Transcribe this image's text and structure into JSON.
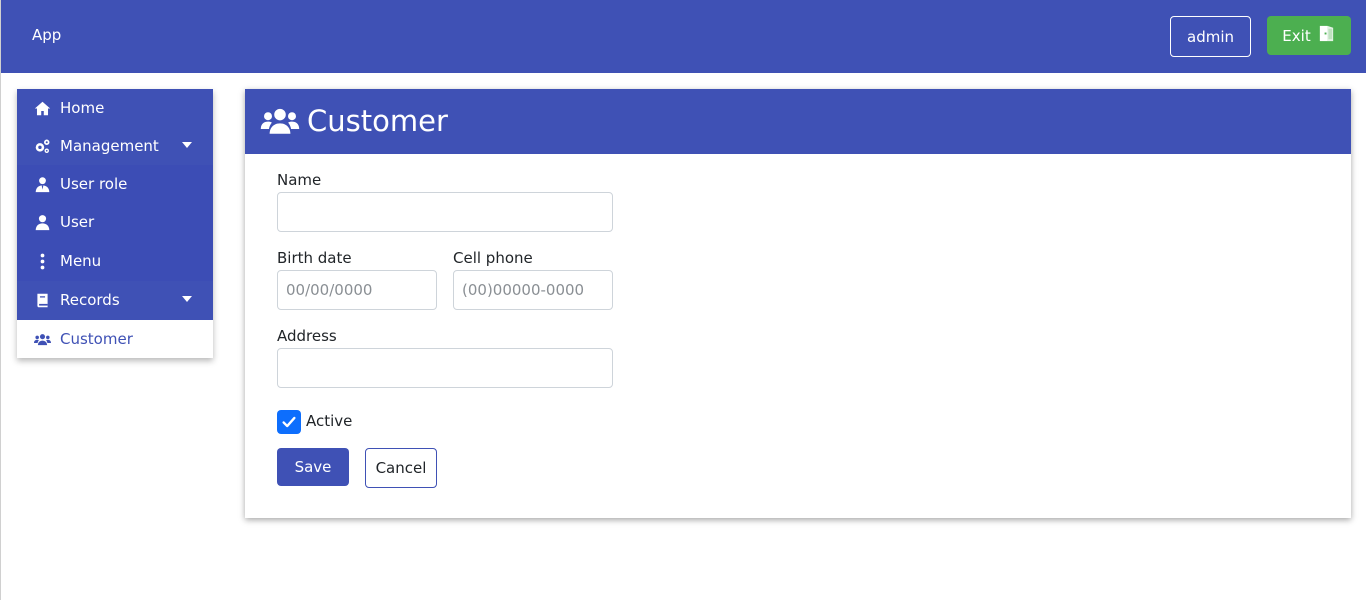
{
  "topbar": {
    "brand": "App",
    "user_button": "admin",
    "exit_button": "Exit",
    "exit_icon": "door-exit-icon",
    "color": "#3f51b5",
    "exit_color": "#4caf50"
  },
  "sidebar": {
    "items": [
      {
        "label": "Home",
        "icon": "home-icon"
      },
      {
        "label": "Management",
        "icon": "cogs-icon",
        "expanded": true
      },
      {
        "label": "User role",
        "icon": "user-tie-icon"
      },
      {
        "label": "User",
        "icon": "user-icon"
      },
      {
        "label": "Menu",
        "icon": "ellipsis-vertical-icon"
      },
      {
        "label": "Records",
        "icon": "book-icon",
        "expanded": true
      },
      {
        "label": "Customer",
        "icon": "users-icon",
        "active": true
      }
    ]
  },
  "page": {
    "title": "Customer",
    "title_icon": "users-icon"
  },
  "form": {
    "name_label": "Name",
    "name_value": "",
    "birth_label": "Birth date",
    "birth_placeholder": "00/00/0000",
    "phone_label": "Cell phone",
    "phone_placeholder": "(00)00000-0000",
    "address_label": "Address",
    "address_value": "",
    "active_label": "Active",
    "active_checked": true,
    "save_label": "Save",
    "cancel_label": "Cancel"
  }
}
